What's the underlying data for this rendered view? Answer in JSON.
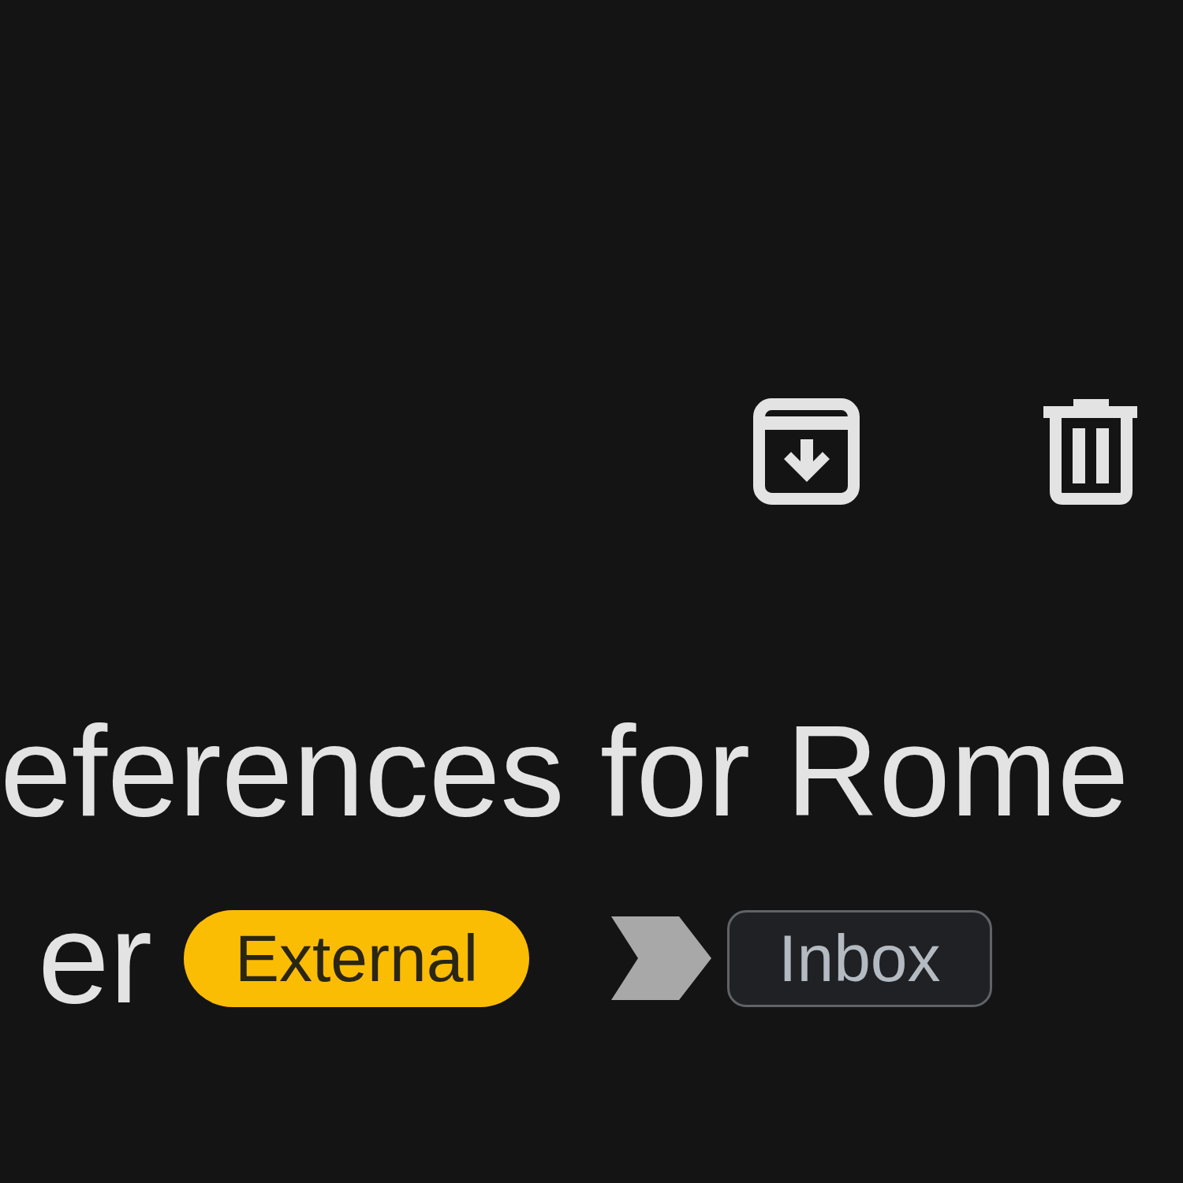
{
  "subject": {
    "lines": [
      "eferences for Rome",
      "er"
    ]
  },
  "external_badge": {
    "label": "External"
  },
  "importance_marker": {
    "important": true
  },
  "labels": [
    {
      "label": "Inbox"
    }
  ]
}
